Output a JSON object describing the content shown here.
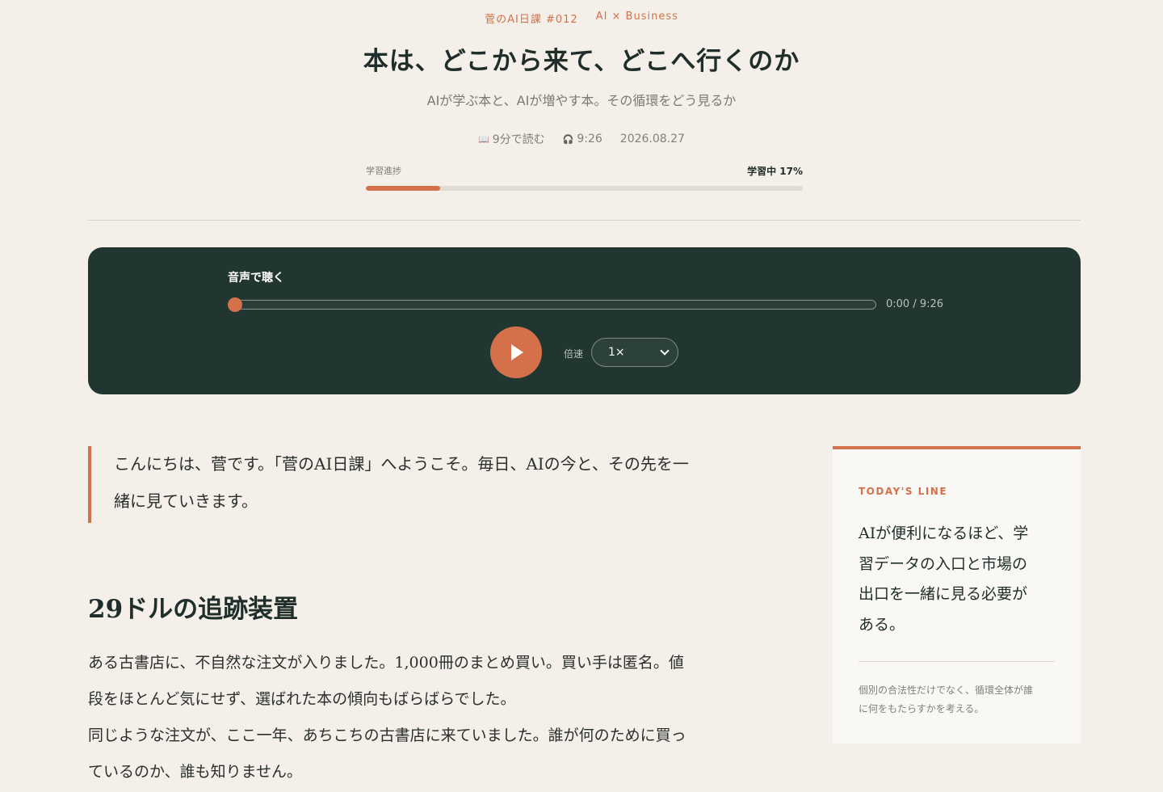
{
  "header": {
    "series": "菅のAI日課 #012",
    "category": "AI × Business",
    "title": "本は、どこから来て、どこへ行くのか",
    "subtitle": "AIが学ぶ本と、AIが増やす本。その循環をどう見るか",
    "meta": {
      "read_time": "9分で読む",
      "read_icon": "book-icon",
      "audio_length": "9:26",
      "audio_icon": "headphones-icon",
      "date": "2026.08.27"
    },
    "progress": {
      "label": "学習進捗",
      "status": "学習中 17%",
      "percent": 17
    }
  },
  "player": {
    "title": "音声で聴く",
    "time": "0:00 / 9:26",
    "position_fraction": 0,
    "speed_label": "倍速",
    "speed_value": "1×"
  },
  "article": {
    "intro_lines": [
      "こんにちは、菅です。「菅のAI日課」へようこそ。毎日、AIの今と、その先を一",
      "緒に見ていきます。"
    ],
    "section_heading": "29ドルの追跡装置",
    "body_lines": [
      "ある古書店に、不自然な注文が入りました。1,000冊のまとめ買い。買い手は匿名。値",
      "段をほとんど気にせず、選ばれた本の傾向もばらばらでした。",
      "同じような注文が、ここ一年、あちこちの古書店に来ていました。誰が何のために買っ",
      "ているのか、誰も知りません。"
    ]
  },
  "sidebar": {
    "label": "TODAY'S LINE",
    "quote_lines": [
      "AIが便利になるほど、学",
      "習データの入口と市場の",
      "出口を一緒に見る必要が",
      "ある。"
    ],
    "note_lines": [
      "個別の合法性だけでなく、循環全体が誰",
      "に何をもたらすかを考える。"
    ]
  },
  "colors": {
    "accent": "#d4714a",
    "player_bg": "#213631",
    "page_bg": "#f4f0e9"
  }
}
